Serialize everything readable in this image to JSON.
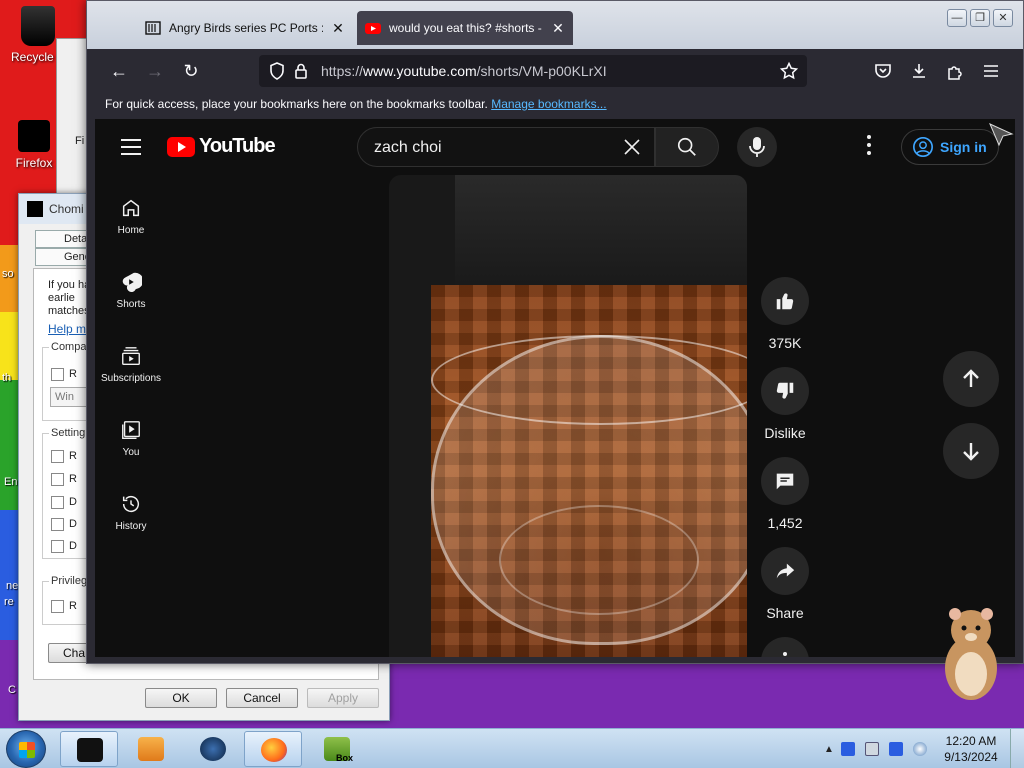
{
  "desktop": {
    "icons": [
      {
        "label": "Recycle B"
      },
      {
        "label": "Firefox"
      }
    ],
    "side_texts": [
      "so",
      "th",
      "En",
      "ne",
      "re",
      "C"
    ],
    "bg_window_label": "Fi"
  },
  "dialog": {
    "title": "Chomi",
    "tabs": [
      "Deta",
      "Genera"
    ],
    "intro_text": "If you ha an earlie matches",
    "help_link": "Help m",
    "group_compat": "Compa",
    "compat_checkbox": "R",
    "compat_combo": "Win",
    "group_settings": "Setting",
    "settings_checkboxes": [
      "R",
      "R",
      "D",
      "D",
      "D"
    ],
    "group_privilege": "Privileg",
    "privilege_checkbox": "R",
    "change_button": "Cha",
    "ok": "OK",
    "cancel": "Cancel",
    "apply": "Apply"
  },
  "browser": {
    "tabs": [
      {
        "title": "Angry Birds series PC Ports : Ro",
        "close": "✕",
        "active": false
      },
      {
        "title": "would you eat this? #shorts - Y",
        "close": "✕",
        "active": true
      }
    ],
    "window_controls": [
      "—",
      "❐",
      "✕"
    ],
    "url_prefix": "https://",
    "url_domain": "www.youtube.com",
    "url_path": "/shorts/VM-p00KLrXI",
    "bookmarks_text": "For quick access, place your bookmarks here on the bookmarks toolbar.",
    "bookmarks_link": "Manage bookmarks..."
  },
  "youtube": {
    "logo_text": "YouTube",
    "search_value": "zach choi",
    "sign_in": "Sign in",
    "guide": [
      "Home",
      "Shorts",
      "Subscriptions",
      "You",
      "History"
    ],
    "actions": {
      "likes": "375K",
      "dislike": "Dislike",
      "comments": "1,452",
      "share": "Share"
    }
  },
  "taskbar": {
    "time": "12:20 AM",
    "date": "9/13/2024",
    "app_label": "Box"
  },
  "colors": {
    "yt_red": "#ff0000",
    "yt_bg": "#0f0f0f",
    "link_blue": "#3ea6ff",
    "ff_dark": "#2b2a33"
  }
}
